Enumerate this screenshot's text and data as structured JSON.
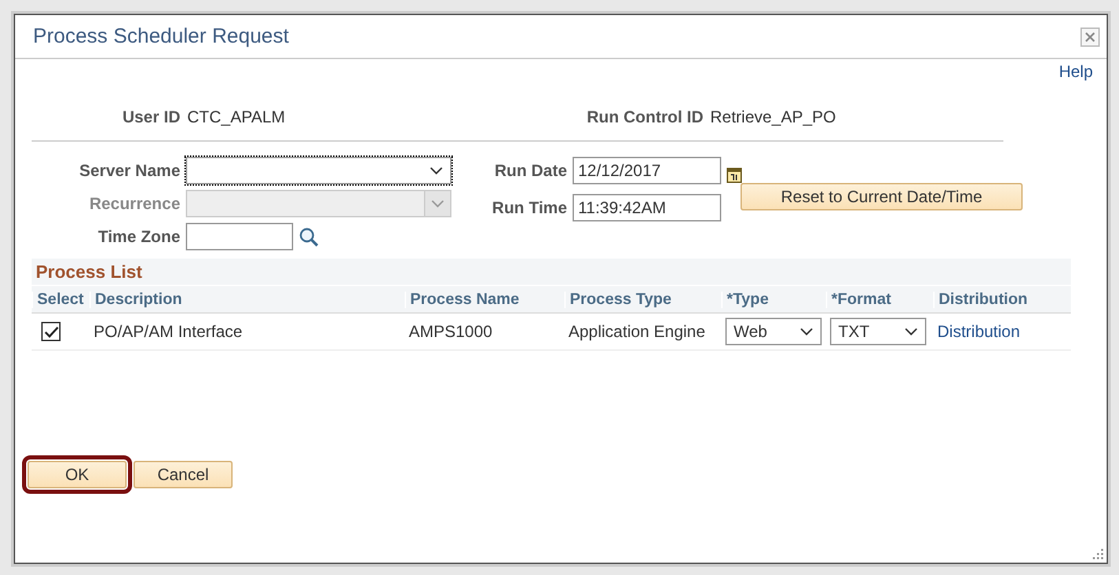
{
  "dialog": {
    "title": "Process Scheduler Request",
    "help_link": "Help"
  },
  "header": {
    "user_id_label": "User ID",
    "user_id": "CTC_APALM",
    "run_control_label": "Run Control ID",
    "run_control_id": "Retrieve_AP_PO"
  },
  "fields": {
    "server_name_label": "Server Name",
    "recurrence_label": "Recurrence",
    "recurrence_disabled": true,
    "time_zone_label": "Time Zone",
    "run_date_label": "Run Date",
    "run_date": "12/12/2017",
    "run_time_label": "Run Time",
    "run_time": "11:39:42AM",
    "reset_button": "Reset to Current Date/Time"
  },
  "process_list": {
    "title": "Process List",
    "columns": [
      "Select",
      "Description",
      "Process Name",
      "Process Type",
      "*Type",
      "*Format",
      "Distribution"
    ],
    "rows": [
      {
        "checked": true,
        "description": "PO/AP/AM Interface",
        "process_name": "AMPS1000",
        "process_type": "Application Engine",
        "type": "Web",
        "format": "TXT",
        "distribution": "Distribution"
      }
    ]
  },
  "buttons": [
    {
      "label": "OK",
      "highlighted": true
    },
    {
      "label": "Cancel",
      "highlighted": false
    }
  ]
}
